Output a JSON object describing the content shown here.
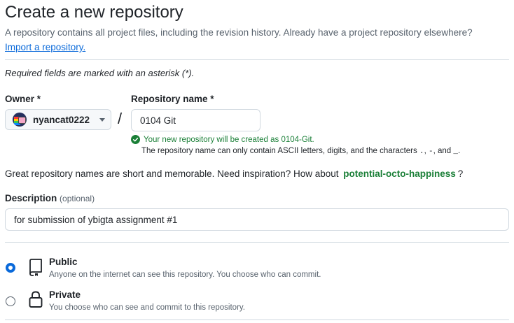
{
  "header": {
    "title": "Create a new repository",
    "subtitle": "A repository contains all project files, including the revision history. Already have a project repository elsewhere?",
    "import_link": "Import a repository."
  },
  "required_note": "Required fields are marked with an asterisk (*).",
  "owner": {
    "label": "Owner *",
    "value": "nyancat0222"
  },
  "separator": "/",
  "repo_name": {
    "label": "Repository name *",
    "value": "0104 Git",
    "availability": "Your new repository will be created as 0104-Git.",
    "hint_prefix": "The repository name can only contain ASCII letters, digits, and the characters",
    "hint_chars_1": ".",
    "hint_sep_1": ",",
    "hint_chars_2": "-",
    "hint_sep_2": ", and",
    "hint_chars_3": "_",
    "hint_end": "."
  },
  "inspiration": {
    "text": "Great repository names are short and memorable. Need inspiration? How about",
    "suggestion": "potential-octo-happiness",
    "suffix": "?"
  },
  "description": {
    "label": "Description",
    "optional": "(optional)",
    "value": "for submission of ybigta assignment #1"
  },
  "visibility": {
    "public": {
      "title": "Public",
      "desc": "Anyone on the internet can see this repository. You choose who can commit.",
      "selected": true
    },
    "private": {
      "title": "Private",
      "desc": "You choose who can see and commit to this repository.",
      "selected": false
    }
  },
  "colors": {
    "accent": "#0969da",
    "success": "#1a7f37",
    "muted": "#59636e",
    "border": "#d1d9e0"
  }
}
